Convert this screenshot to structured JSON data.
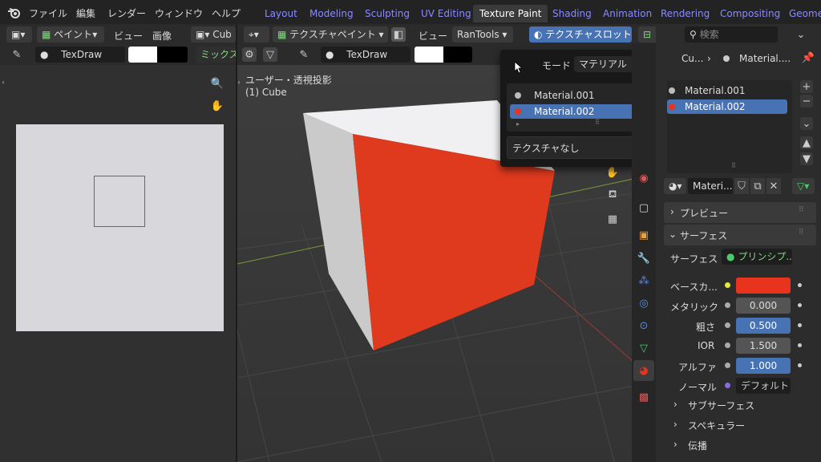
{
  "menu": {
    "file": "ファイル",
    "edit": "編集",
    "render": "レンダー",
    "window": "ウィンドウ",
    "help": "ヘルプ"
  },
  "workspaces": [
    "Layout",
    "Modeling",
    "Sculpting",
    "UV Editing",
    "Texture Paint",
    "Shading",
    "Animation",
    "Rendering",
    "Compositing",
    "Geometr"
  ],
  "left_header": {
    "mode": "ペイント",
    "view": "ビュー",
    "image": "画像",
    "object": "Cub"
  },
  "left_tool": {
    "brush": "TexDraw",
    "blend": "ミックス"
  },
  "vp_header": {
    "mode": "テクスチャペイント",
    "view": "ビュー",
    "addon": "RanTools",
    "slots": "テクスチャスロット"
  },
  "vp_tool": {
    "brush": "TexDraw"
  },
  "viewport": {
    "projection": "ユーザー・透視投影",
    "object": "(1) Cube"
  },
  "popup": {
    "mode_label": "モード",
    "mode_value": "マテリアル",
    "materials": [
      "Material.001",
      "Material.002"
    ],
    "texture": "テクスチャなし"
  },
  "props": {
    "search_placeholder": "検索",
    "breadcrumb": [
      "Cu...",
      "Material...."
    ],
    "slots": [
      "Material.001",
      "Material.002"
    ],
    "material_name": "Materi...",
    "preview": "プレビュー",
    "surface_section": "サーフェス",
    "surface_label": "サーフェス",
    "surface_value": "プリンシプ...",
    "rows": [
      {
        "label": "ベースカ...",
        "value": ""
      },
      {
        "label": "メタリック",
        "value": "0.000"
      },
      {
        "label": "粗さ",
        "value": "0.500"
      },
      {
        "label": "IOR",
        "value": "1.500"
      },
      {
        "label": "アルファ",
        "value": "1.000"
      },
      {
        "label": "ノーマル",
        "value": "デフォルト"
      }
    ],
    "subsections": [
      "サブサーフェス",
      "スペキュラー",
      "伝播"
    ]
  },
  "colors": {
    "base_color": "#e8341c",
    "cube_red": "#e03a1e",
    "accent": "#4772b3"
  }
}
